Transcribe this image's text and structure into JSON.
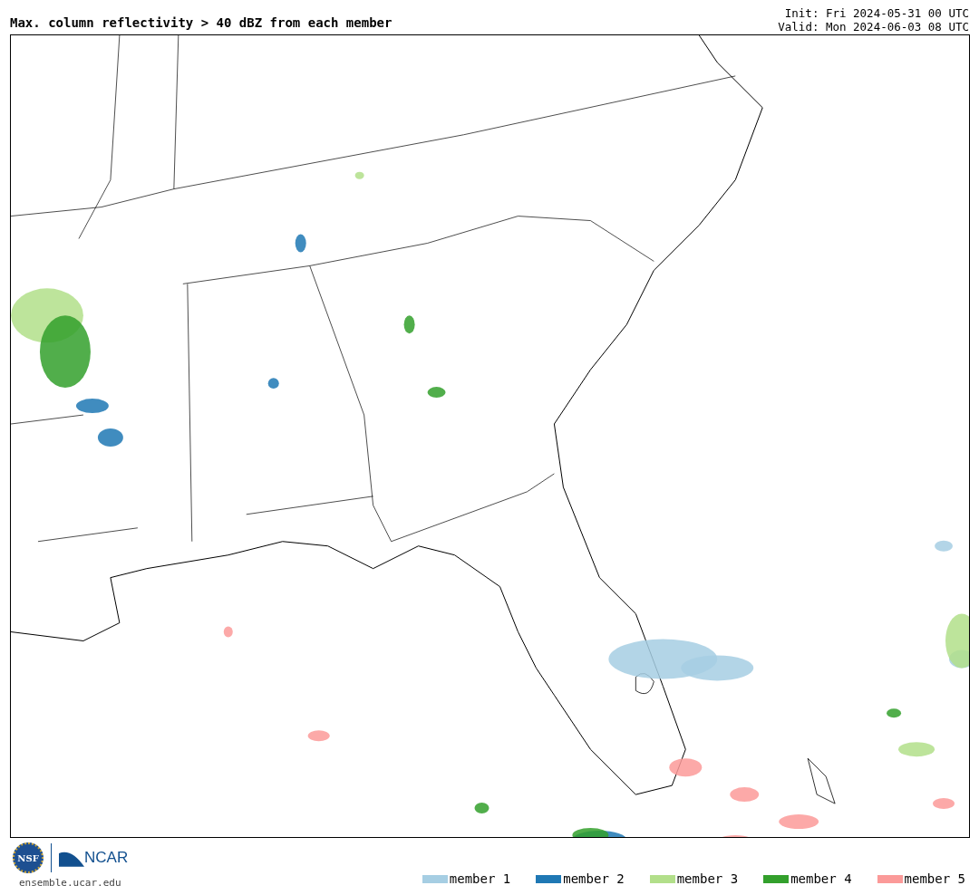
{
  "title": "Max. column reflectivity > 40 dBZ from each member",
  "init": "Init: Fri 2024-05-31 00 UTC",
  "valid": "Valid: Mon 2024-06-03 08 UTC",
  "logos": {
    "seal": "NSF",
    "brand": "NCAR",
    "url": "ensemble.ucar.edu"
  },
  "legend": [
    {
      "label": "member 1",
      "color": "#a6cee3"
    },
    {
      "label": "member 2",
      "color": "#1f78b4"
    },
    {
      "label": "member 3",
      "color": "#b2df8a"
    },
    {
      "label": "member 4",
      "color": "#33a02c"
    },
    {
      "label": "member 5",
      "color": "#fb9a99"
    }
  ]
}
